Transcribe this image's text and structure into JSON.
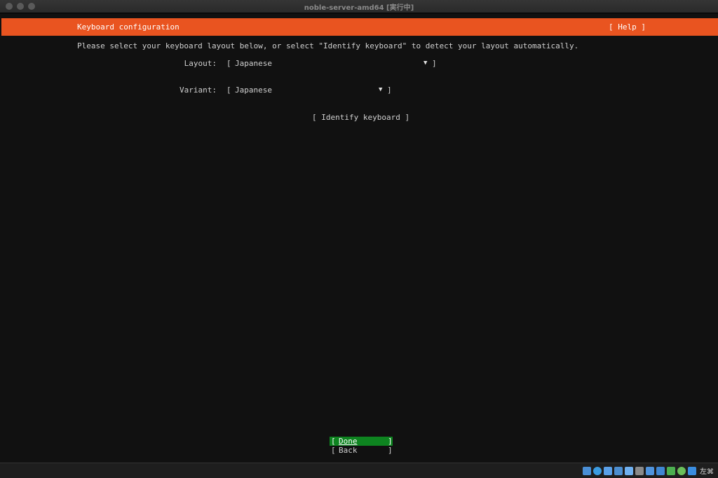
{
  "window": {
    "title": "noble-server-amd64 [実行中]"
  },
  "header": {
    "title": "Keyboard configuration",
    "help_label": "[ Help ]"
  },
  "intro_text": "Please select your keyboard layout below, or select \"Identify keyboard\" to detect your layout automatically.",
  "form": {
    "layout": {
      "label": "Layout:",
      "open_bracket": "[",
      "value": "Japanese",
      "close_bracket": "]"
    },
    "variant": {
      "label": "Variant:",
      "open_bracket": "[",
      "value": "Japanese",
      "close_bracket": "]"
    },
    "identify_button": "[ Identify keyboard ]"
  },
  "buttons": {
    "done": {
      "open": "[",
      "label": "Done",
      "close": "]"
    },
    "back": {
      "open": "[",
      "label": "Back",
      "close": "]"
    }
  },
  "statusbar": {
    "icons": [
      "hard-disk-icon",
      "optical-drive-icon",
      "audio-icon",
      "network-icon",
      "usb-icon",
      "shared-folder-icon",
      "display-icon",
      "recording-icon",
      "cpu-icon",
      "guest-additions-icon",
      "mouse-integration-icon",
      "keyboard-capture-icon"
    ],
    "host_key": "左⌘"
  },
  "colors": {
    "accent": "#e95420",
    "done_bg": "#0e8420",
    "background": "#111111"
  }
}
